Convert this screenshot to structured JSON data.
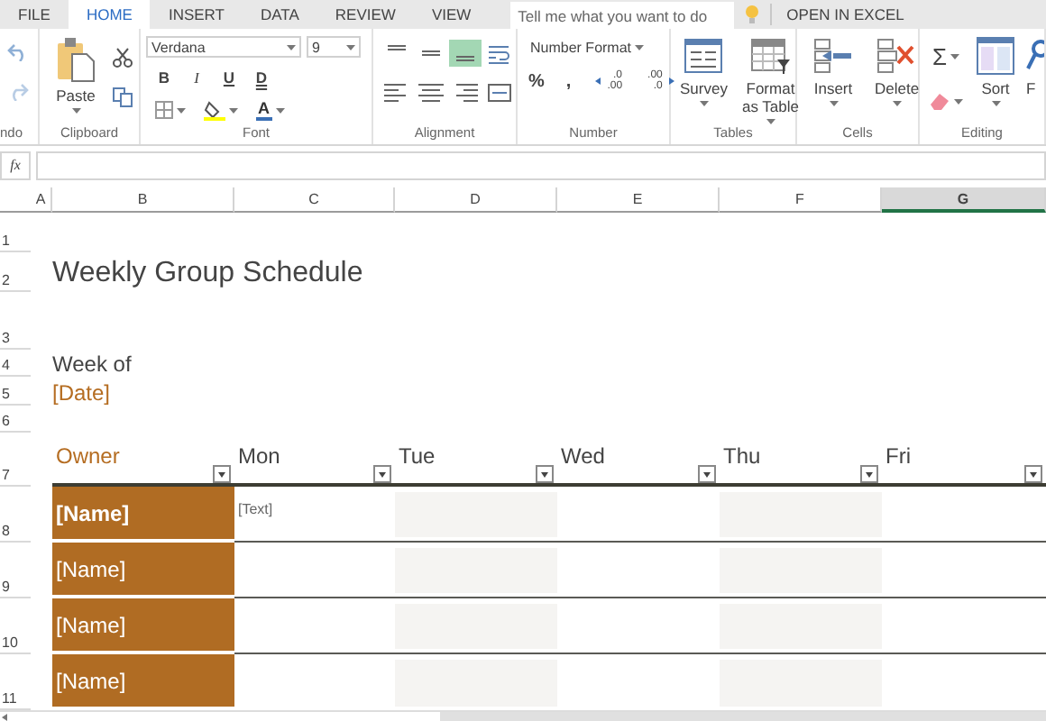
{
  "ribbon_tabs": [
    {
      "label": "FILE",
      "selected": false
    },
    {
      "label": "HOME",
      "selected": true
    },
    {
      "label": "INSERT",
      "selected": false
    },
    {
      "label": "DATA",
      "selected": false
    },
    {
      "label": "REVIEW",
      "selected": false
    },
    {
      "label": "VIEW",
      "selected": false
    }
  ],
  "tell_me": {
    "placeholder": "Tell me what you want to do"
  },
  "open_in_excel": "OPEN IN EXCEL",
  "ribbon_groups": [
    {
      "kind": "undo",
      "label": "ndo"
    },
    {
      "kind": "clipboard",
      "label": "Clipboard",
      "paste": "Paste"
    },
    {
      "kind": "font",
      "label": "Font",
      "font_name": "Verdana",
      "font_size": "9",
      "styles": [
        "B",
        "I",
        "U",
        "D"
      ],
      "color_letter": "A"
    },
    {
      "kind": "alignment",
      "label": "Alignment",
      "buttons": [
        {
          "kind": "top",
          "selected": false
        },
        {
          "kind": "middle",
          "selected": false
        },
        {
          "kind": "bottom",
          "selected": true
        },
        {
          "kind": "wrap",
          "selected": false
        },
        {
          "kind": "left",
          "selected": false
        },
        {
          "kind": "center",
          "selected": false
        },
        {
          "kind": "right",
          "selected": false
        },
        {
          "kind": "merge",
          "selected": false
        }
      ]
    },
    {
      "kind": "number",
      "label": "Number",
      "format": "Number Format",
      "buttons": [
        {
          "kind": "percent",
          "text": "%"
        },
        {
          "kind": "comma",
          "text": ","
        },
        {
          "kind": "increase_decimal",
          "text": ".0\n.00"
        },
        {
          "kind": "decrease_decimal",
          "text": ".00\n.0"
        }
      ]
    },
    {
      "kind": "tables",
      "label": "Tables",
      "buttons": [
        "Survey",
        "Format\nas Table"
      ]
    },
    {
      "kind": "cells",
      "label": "Cells",
      "buttons": [
        "Insert",
        "Delete"
      ]
    },
    {
      "kind": "editing",
      "label": "Editing",
      "sum": "Σ",
      "buttons": [
        "Sort",
        "F"
      ]
    }
  ],
  "formula_bar": {
    "function_label": "fx"
  },
  "column_headers": [
    {
      "label": "A",
      "selected": false
    },
    {
      "label": "B",
      "selected": false
    },
    {
      "label": "C",
      "selected": false
    },
    {
      "label": "D",
      "selected": false
    },
    {
      "label": "E",
      "selected": false
    },
    {
      "label": "F",
      "selected": false
    },
    {
      "label": "G",
      "selected": true
    }
  ],
  "row_numbers": [
    "1",
    "2",
    "3",
    "4",
    "5",
    "6",
    "7",
    "8",
    "9",
    "10",
    "11"
  ],
  "schedule": {
    "title": "Weekly Group Schedule",
    "week_label": "Week of",
    "date": "[Date]",
    "headers": [
      "Owner",
      "Mon",
      "Tue",
      "Wed",
      "Thu",
      "Fri"
    ],
    "rows": [
      {
        "owner": "[Name]",
        "bold": true,
        "mon": "[Text]"
      },
      {
        "owner": "[Name]",
        "bold": false
      },
      {
        "owner": "[Name]",
        "bold": false
      },
      {
        "owner": "[Name]",
        "bold": false
      }
    ]
  }
}
